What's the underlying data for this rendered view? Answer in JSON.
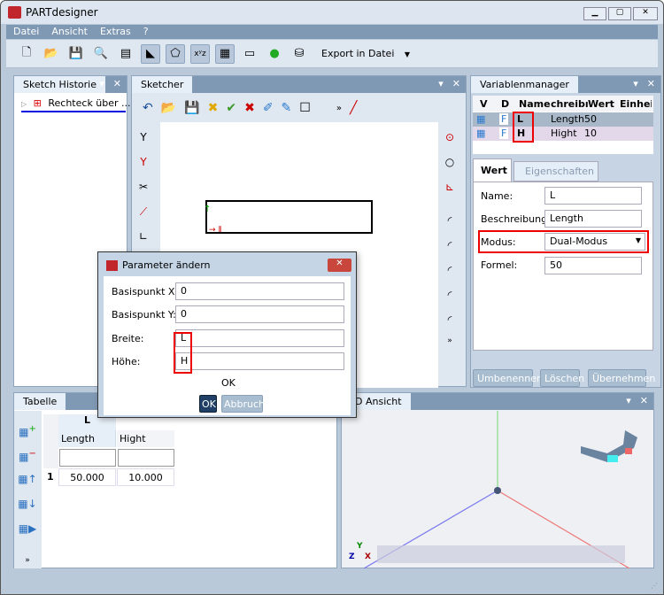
{
  "app": {
    "title": "PARTdesigner"
  },
  "menu": [
    "Datei",
    "Ansicht",
    "Extras",
    "?"
  ],
  "toolbar": {
    "export_label": "Export in Datei"
  },
  "sketch_history": {
    "tab": "Sketch Historie",
    "items": [
      {
        "label": "Rechteck über ..."
      }
    ]
  },
  "sketcher": {
    "tab": "Sketcher"
  },
  "variable_manager": {
    "tab": "Variablenmanager",
    "columns": [
      "V",
      "D",
      "Name",
      "chreibı",
      "Wert",
      "Einheit"
    ],
    "rows": [
      {
        "d": "F",
        "name": "L",
        "desc": "Length",
        "value": "50",
        "unit": ""
      },
      {
        "d": "F",
        "name": "H",
        "desc": "Hight",
        "value": "10",
        "unit": ""
      }
    ],
    "tabs": [
      "Wert",
      "Eigenschaften"
    ],
    "name_label": "Name:",
    "name_value": "L",
    "desc_label": "Beschreibung:",
    "desc_value": "Length",
    "mode_label": "Modus:",
    "mode_value": "Dual-Modus",
    "formula_label": "Formel:",
    "formula_value": "50",
    "buttons": [
      "Umbenennen",
      "Löschen",
      "Übernehmen"
    ]
  },
  "table": {
    "tab": "Tabelle",
    "var_header": "L",
    "columns": [
      "Length",
      "Hight"
    ],
    "rows": [
      {
        "index": "1",
        "values": [
          "50.000",
          "10.000"
        ]
      }
    ]
  },
  "view3d": {
    "tab": "3D Ansicht",
    "axes": [
      "Y",
      "Z",
      "X"
    ]
  },
  "dialog": {
    "title": "Parameter ändern",
    "fields": [
      {
        "label": "Basispunkt X:",
        "value": "0"
      },
      {
        "label": "Basispunkt Y:",
        "value": "0"
      },
      {
        "label": "Breite:",
        "value": "L"
      },
      {
        "label": "Höhe:",
        "value": "H"
      }
    ],
    "status": "OK",
    "ok": "OK",
    "cancel": "Abbruch"
  },
  "colors": {
    "highlight": "#e00000",
    "panel_header": "#7f98b3",
    "accent": "#1f3f66"
  }
}
